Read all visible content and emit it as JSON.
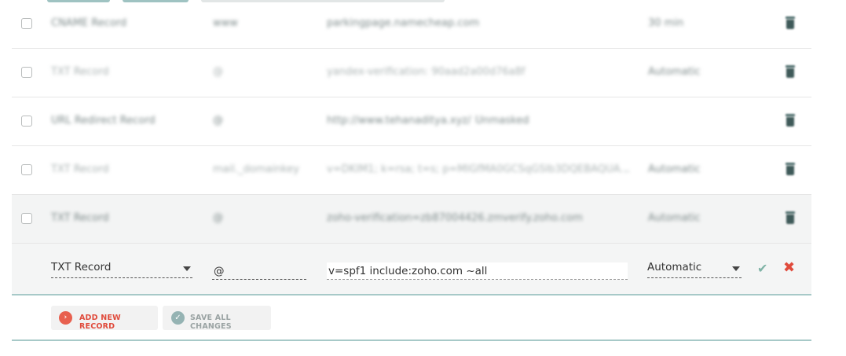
{
  "records": [
    {
      "type": "CNAME Record",
      "host": "www",
      "value": "parkingpage.namecheap.com",
      "value2": "",
      "ttl": "30 min"
    },
    {
      "type": "TXT Record",
      "host": "@",
      "value": "yandex-verification: 90aad2a00d76a8f",
      "value2": "",
      "ttl": "Automatic"
    },
    {
      "type": "URL Redirect Record",
      "host": "@",
      "value": "http://www.tehanaditya.xyz/",
      "value2": "Unmasked",
      "ttl": ""
    },
    {
      "type": "TXT Record",
      "host": "mail._domainkey",
      "value": "v=DKIM1; k=rsa; t=s; p=MIGfMA0GCSqGSIb3DQEBAQUA...",
      "value2": "",
      "ttl": "Automatic"
    },
    {
      "type": "TXT Record",
      "host": "@",
      "value": "zoho-verification=zb87004426.zmverify.zoho.com",
      "value2": "",
      "ttl": "Automatic"
    }
  ],
  "edit": {
    "type": "TXT Record",
    "host": "@",
    "value": "v=spf1 include:zoho.com ~all",
    "ttl": "Automatic",
    "confirm_icon": "check-icon",
    "cancel_icon": "close-icon"
  },
  "actions": {
    "add_label": "ADD NEW RECORD",
    "save_label": "SAVE ALL CHANGES"
  },
  "colors": {
    "accent": "#a7c9c8",
    "danger": "#e04b3c",
    "confirm": "#7fb3a6"
  }
}
